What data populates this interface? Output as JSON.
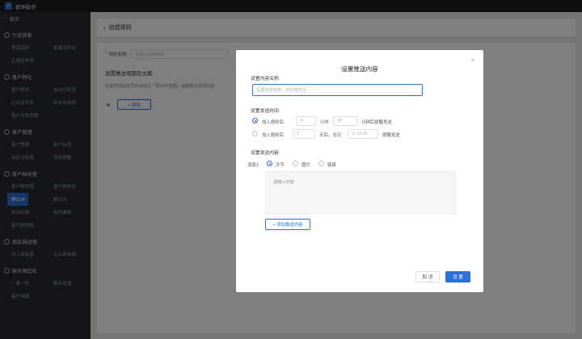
{
  "app": {
    "title": "群伴助手",
    "logo_glyph": "✓",
    "accent": "#2c6fd6"
  },
  "sidebar": {
    "home": "首页",
    "groups": [
      {
        "title": "引流获客",
        "items": [
          "渠道活码",
          "批量加好友",
          "企微任务宝"
        ]
      },
      {
        "title": "客户转化",
        "items": [
          "客户群发",
          "自动打标签",
          "企业话术库",
          "好友欢迎语",
          "客户生命周期"
        ]
      },
      {
        "title": "客户管理",
        "items": [
          "客户管理",
          "客户标签",
          "自定义信息",
          "流失提醒"
        ]
      },
      {
        "title": "客户群运营",
        "items": [
          "客户群列表",
          "客户群群发",
          "群SOP",
          "群日历",
          "自动拉群",
          "标签建群",
          "客户群提醒"
        ]
      },
      {
        "title": "朋友圈运营",
        "items": [
          "员工朋友圈",
          "企业朋友圈"
        ]
      },
      {
        "title": "聊天侧边栏",
        "items": [
          "一客一码",
          "聊天增强",
          "客户画像"
        ]
      }
    ],
    "active_item": "群SOP"
  },
  "page": {
    "back_icon": "‹",
    "title": "创建规则",
    "rule_name_label": "规则名称:",
    "rule_name_placeholder": "请输入规则名称",
    "section_title": "设置推送周期及文案",
    "section_desc": "设置规则后成员将会通过「群SOP提醒」提醒群主推送内容",
    "add_button": "+ 添加"
  },
  "dialog": {
    "title": "设置推送内容",
    "close_icon": "×",
    "name_label": "设置内容名称:",
    "name_placeholder": "设置内容名称，仅内部可见",
    "time_label": "设置发送时间:",
    "time_option_1": {
      "prefix": "加入规则后",
      "hours": "0",
      "hours_unit": "小时",
      "minutes": "30",
      "suffix": "分钟后提醒发送"
    },
    "time_option_2": {
      "prefix": "加入规则后",
      "days": "1",
      "days_mid": "天后，当日",
      "time": "12:00",
      "suffix": "提醒发送"
    },
    "content_label": "设置发送内容:",
    "message_label": "消息1:",
    "types": [
      "文字",
      "图片",
      "链接"
    ],
    "content_placeholder": "请输入内容",
    "add_content": "+ 添加推送内容",
    "cancel": "取 消",
    "confirm": "设 置"
  }
}
